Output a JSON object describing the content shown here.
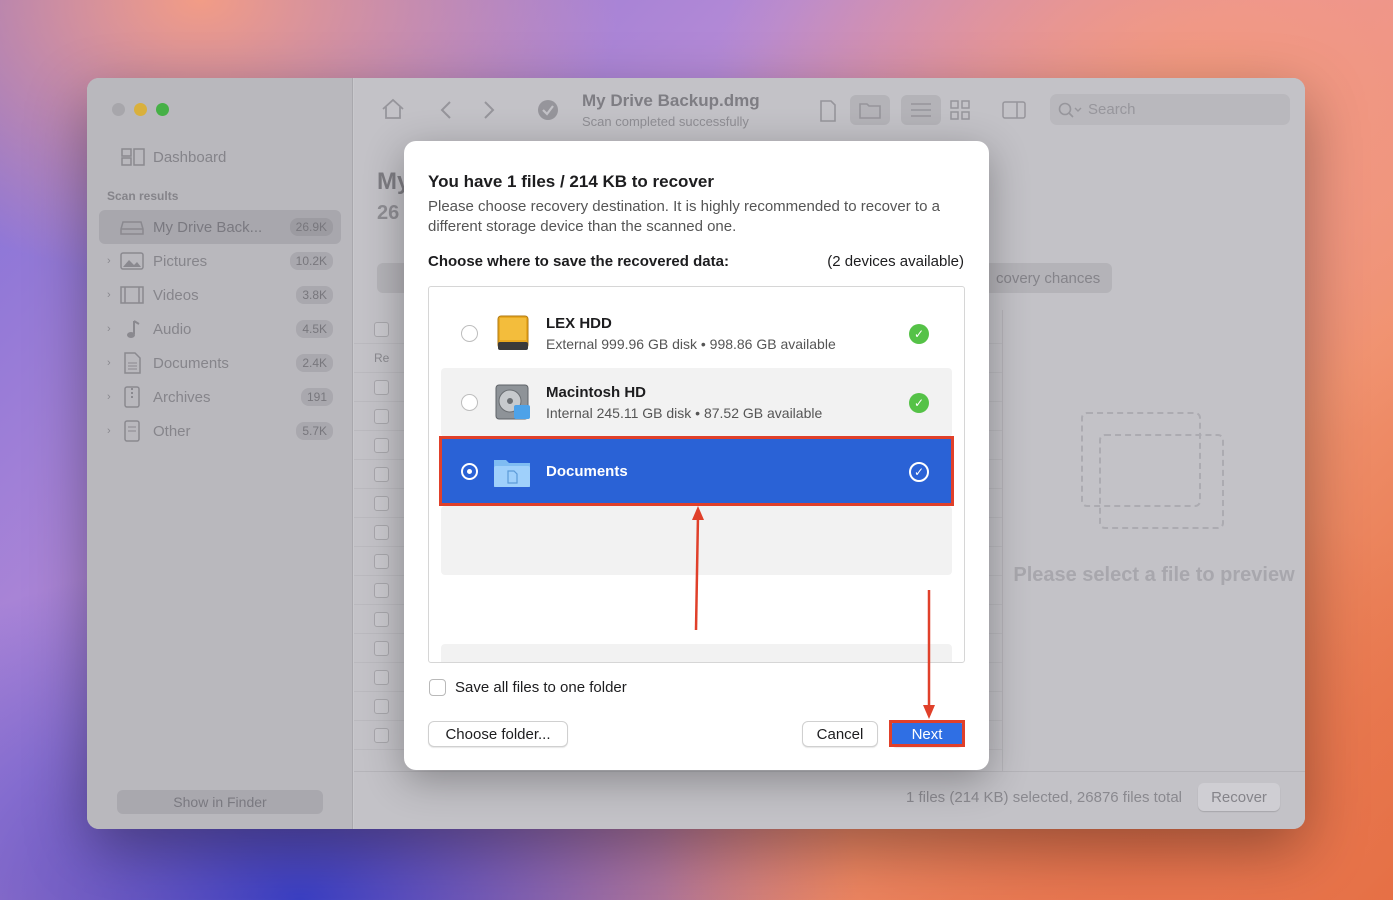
{
  "window": {
    "title": "My Drive Backup.dmg",
    "subtitle": "Scan completed successfully",
    "search_placeholder": "Search"
  },
  "sidebar": {
    "dashboard_label": "Dashboard",
    "section_label": "Scan results",
    "items": [
      {
        "label": "My Drive Back...",
        "count": "26.9K",
        "icon": "drive-icon"
      },
      {
        "label": "Pictures",
        "count": "10.2K",
        "icon": "pictures-icon"
      },
      {
        "label": "Videos",
        "count": "3.8K",
        "icon": "videos-icon"
      },
      {
        "label": "Audio",
        "count": "4.5K",
        "icon": "audio-icon"
      },
      {
        "label": "Documents",
        "count": "2.4K",
        "icon": "documents-icon"
      },
      {
        "label": "Archives",
        "count": "191",
        "icon": "archives-icon"
      },
      {
        "label": "Other",
        "count": "5.7K",
        "icon": "other-icon"
      }
    ],
    "show_in_finder": "Show in Finder"
  },
  "background": {
    "title_fragment": "My",
    "count_fragment": "26",
    "chances_label": "covery chances",
    "table_header_fragment": "Re",
    "preview_text": "Please select a file to preview"
  },
  "statusbar": {
    "selection_text": "1 files (214 KB) selected, 26876 files total",
    "recover_label": "Recover"
  },
  "dialog": {
    "title": "You have 1 files / 214 KB to recover",
    "description": "Please choose recovery destination. It is highly recommended to recover to a different storage device than the scanned one.",
    "choose_label": "Choose where to save the recovered data:",
    "devices_available": "(2 devices available)",
    "devices": [
      {
        "name": "LEX HDD",
        "detail": "External 999.96 GB disk • 998.86 GB available",
        "selected": false
      },
      {
        "name": "Macintosh HD",
        "detail": "Internal 245.11 GB disk • 87.52 GB available",
        "selected": false
      },
      {
        "name": "Documents",
        "detail": "",
        "selected": true
      }
    ],
    "save_all_label": "Save all files to one folder",
    "choose_folder_label": "Choose folder...",
    "cancel_label": "Cancel",
    "next_label": "Next"
  },
  "colors": {
    "accent": "#2a62d6",
    "highlight": "#e0402a",
    "ok_green": "#55c247"
  }
}
